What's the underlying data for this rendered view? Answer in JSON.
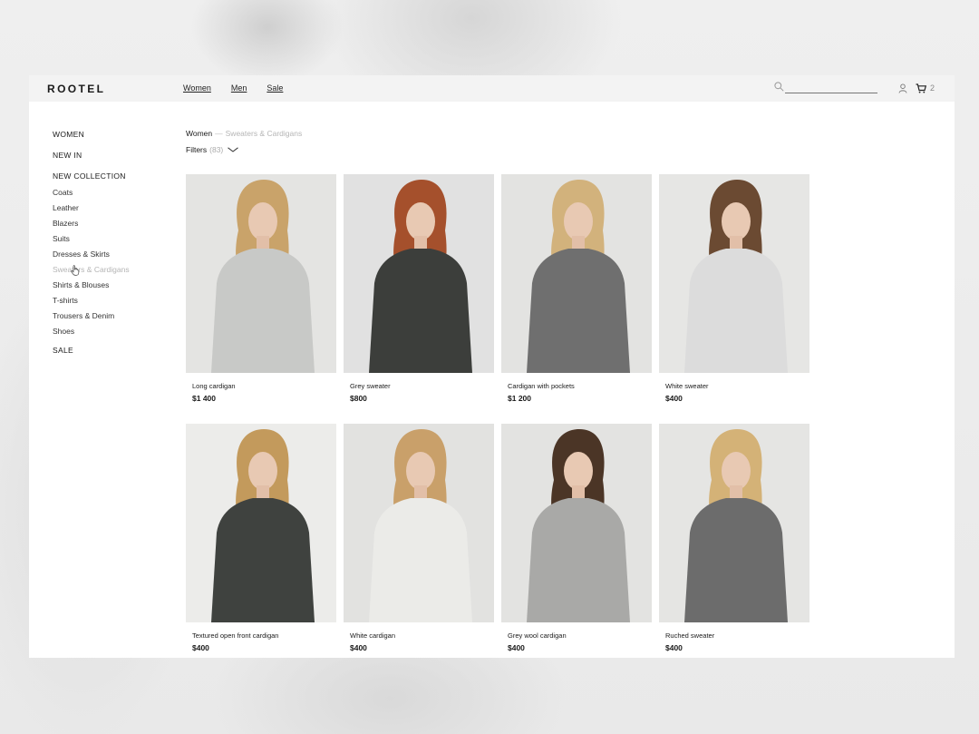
{
  "brand": {
    "logo": "ROOTEL"
  },
  "nav": {
    "items": [
      "Women",
      "Men",
      "Sale"
    ]
  },
  "search": {
    "value": "",
    "placeholder": ""
  },
  "cart": {
    "count": "2"
  },
  "sidebar": {
    "women": "WOMEN",
    "new_in": "NEW IN",
    "new_collection": "NEW COLLECTION",
    "items": [
      "Coats",
      "Leather",
      "Blazers",
      "Suits",
      "Dresses & Skirts",
      "Sweaters & Cardigans",
      "Shirts & Blouses",
      "T-shirts",
      "Trousers & Denim",
      "Shoes"
    ],
    "sale": "SALE"
  },
  "breadcrumb": {
    "section": "Women",
    "separator": "—",
    "current": "Sweaters & Cardigans"
  },
  "filters": {
    "label": "Filters",
    "count": "(83)"
  },
  "products": [
    {
      "name": "Long cardigan",
      "price": "$1 400",
      "garment": "#c8c9c7",
      "hair": "#c9a36a",
      "bg": "#e4e4e2"
    },
    {
      "name": "Grey sweater",
      "price": "$800",
      "garment": "#3c3e3b",
      "hair": "#a5502c",
      "bg": "#e1e1e1"
    },
    {
      "name": "Cardigan with pockets",
      "price": "$1 200",
      "garment": "#6f6f6f",
      "hair": "#d2b27c",
      "bg": "#e3e3e1"
    },
    {
      "name": "White sweater",
      "price": "$400",
      "garment": "#dcdcdc",
      "hair": "#6b4a32",
      "bg": "#e6e6e4"
    },
    {
      "name": "Textured open front cardigan",
      "price": "$400",
      "garment": "#3f423f",
      "hair": "#c39a5c",
      "bg": "#ececea"
    },
    {
      "name": "White cardigan",
      "price": "$400",
      "garment": "#ebebe8",
      "hair": "#c9a06a",
      "bg": "#e2e2e0"
    },
    {
      "name": "Grey wool cardigan",
      "price": "$400",
      "garment": "#a9a9a7",
      "hair": "#4b3526",
      "bg": "#e3e3e1"
    },
    {
      "name": "Ruched sweater",
      "price": "$400",
      "garment": "#6c6c6c",
      "hair": "#d4b277",
      "bg": "#e5e5e3"
    }
  ]
}
